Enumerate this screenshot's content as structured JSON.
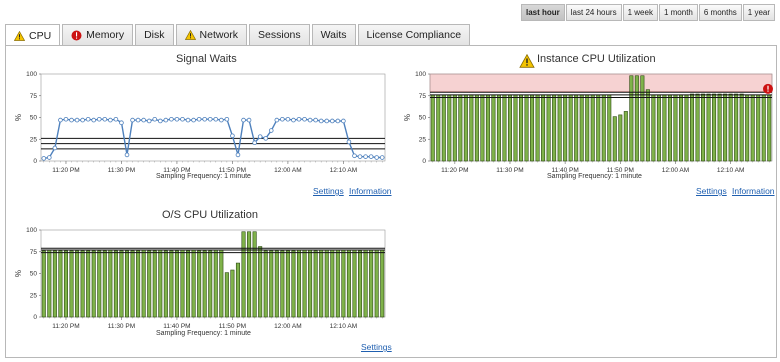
{
  "time_ranges": [
    {
      "label": "last hour",
      "active": true
    },
    {
      "label": "last 24 hours",
      "active": false
    },
    {
      "label": "1 week",
      "active": false
    },
    {
      "label": "1 month",
      "active": false
    },
    {
      "label": "6 months",
      "active": false
    },
    {
      "label": "1 year",
      "active": false
    }
  ],
  "tabs": [
    {
      "label": "CPU",
      "icon": "warning-icon",
      "active": true
    },
    {
      "label": "Memory",
      "icon": "error-icon",
      "active": false
    },
    {
      "label": "Disk",
      "icon": "",
      "active": false
    },
    {
      "label": "Network",
      "icon": "warning-icon",
      "active": false
    },
    {
      "label": "Sessions",
      "icon": "",
      "active": false
    },
    {
      "label": "Waits",
      "icon": "",
      "active": false
    },
    {
      "label": "License Compliance",
      "icon": "",
      "active": false
    }
  ],
  "colors": {
    "line": "#4f81bd",
    "bar_fill": "#7fb24a",
    "bar_stroke": "#2c4a12",
    "threshold_zone": "#f6d2d2",
    "warning": "#f4c400",
    "error": "#cc1111",
    "link": "#1f5fb0"
  },
  "charts": {
    "signal_waits": {
      "title": "Signal Waits",
      "sampling": "Sampling Frequency: 1 minute",
      "links": {
        "settings": "Settings",
        "information": "Information"
      },
      "chart_data": {
        "type": "line",
        "ylabel": "%",
        "ylim": [
          0,
          100
        ],
        "y_ticks": [
          "0",
          "25",
          "50",
          "75",
          "100"
        ],
        "x_ticks": [
          "11:20 PM",
          "11:30 PM",
          "11:40 PM",
          "11:50 PM",
          "12:00 AM",
          "12:10 AM"
        ],
        "baselines": [
          14,
          20,
          26
        ],
        "values": [
          3,
          4,
          15,
          47,
          48,
          47,
          47,
          47,
          48,
          47,
          48,
          48,
          47,
          48,
          44,
          7,
          47,
          47,
          47,
          46,
          48,
          46,
          47,
          48,
          48,
          48,
          47,
          47,
          48,
          48,
          48,
          48,
          47,
          48,
          29,
          7,
          47,
          47,
          21,
          28,
          26,
          35,
          47,
          48,
          48,
          47,
          48,
          48,
          47,
          47,
          46,
          46,
          46,
          46,
          46,
          22,
          6,
          5,
          5,
          5,
          4,
          4
        ]
      }
    },
    "instance_cpu": {
      "title": "Instance CPU Utilization",
      "sampling": "Sampling Frequency: 1 minute",
      "links": {
        "settings": "Settings",
        "information": "Information"
      },
      "chart_data": {
        "type": "bar",
        "ylabel": "%",
        "ylim": [
          0,
          100
        ],
        "y_ticks": [
          "0",
          "25",
          "50",
          "75",
          "100"
        ],
        "x_ticks": [
          "11:20 PM",
          "11:30 PM",
          "11:40 PM",
          "11:50 PM",
          "12:00 AM",
          "12:10 AM"
        ],
        "threshold_zone": [
          80,
          100
        ],
        "baselines": [
          73,
          76,
          79
        ],
        "values": [
          76,
          76,
          76,
          76,
          76,
          76,
          76,
          76,
          76,
          76,
          76,
          76,
          76,
          76,
          76,
          76,
          76,
          76,
          76,
          76,
          76,
          76,
          76,
          76,
          76,
          76,
          76,
          76,
          76,
          76,
          76,
          76,
          76,
          51,
          53,
          57,
          98,
          98,
          98,
          82,
          76,
          76,
          76,
          76,
          76,
          76,
          76,
          77,
          77,
          77,
          77,
          77,
          77,
          77,
          77,
          77,
          77,
          76,
          76,
          76,
          76,
          76
        ]
      }
    },
    "os_cpu": {
      "title": "O/S CPU Utilization",
      "sampling": "Sampling Frequency: 1 minute",
      "links": {
        "settings": "Settings"
      },
      "chart_data": {
        "type": "bar",
        "ylabel": "%",
        "ylim": [
          0,
          100
        ],
        "y_ticks": [
          "0",
          "25",
          "50",
          "75",
          "100"
        ],
        "x_ticks": [
          "11:20 PM",
          "11:30 PM",
          "11:40 PM",
          "11:50 PM",
          "12:00 AM",
          "12:10 AM"
        ],
        "baselines": [
          74,
          77,
          79
        ],
        "values": [
          76,
          77,
          76,
          76,
          76,
          76,
          76,
          76,
          76,
          76,
          76,
          76,
          77,
          76,
          76,
          76,
          76,
          76,
          77,
          76,
          76,
          77,
          76,
          76,
          76,
          77,
          76,
          77,
          76,
          76,
          76,
          77,
          77,
          51,
          54,
          62,
          98,
          98,
          98,
          81,
          76,
          76,
          76,
          76,
          76,
          76,
          77,
          77,
          77,
          76,
          77,
          77,
          77,
          77,
          77,
          77,
          77,
          76,
          77,
          77,
          77,
          77
        ]
      }
    }
  }
}
